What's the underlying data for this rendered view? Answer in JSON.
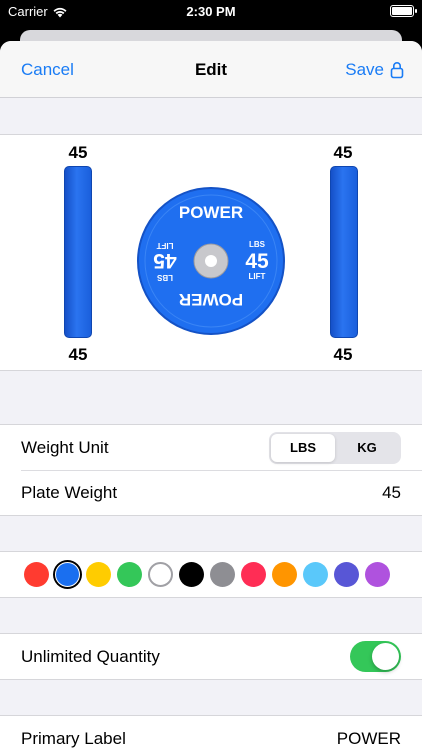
{
  "status_bar": {
    "carrier": "Carrier",
    "time": "2:30 PM"
  },
  "nav": {
    "cancel_label": "Cancel",
    "title": "Edit",
    "save_label": "Save"
  },
  "preview": {
    "bar_value": "45",
    "plate": {
      "top_text": "POWER",
      "bottom_text": "POWER",
      "weight": "45",
      "unit": "LBS",
      "lift": "LIFT",
      "color": "#1f6ff0"
    }
  },
  "weight_unit": {
    "label": "Weight Unit",
    "options": [
      "LBS",
      "KG"
    ],
    "selected": "LBS"
  },
  "plate_weight": {
    "label": "Plate Weight",
    "value": "45"
  },
  "color_palette": {
    "swatches": [
      "#ff3b30",
      "#1a6ff0",
      "#ffcc00",
      "#34c759",
      "#ffffff",
      "#000000",
      "#8e8e93",
      "#ff2d55",
      "#ff9500",
      "#5ac8fa",
      "#5856d6",
      "#af52de"
    ],
    "selected_index": 1
  },
  "unlimited_quantity": {
    "label": "Unlimited Quantity",
    "enabled": true
  },
  "primary_label": {
    "label": "Primary Label",
    "value": "POWER"
  }
}
